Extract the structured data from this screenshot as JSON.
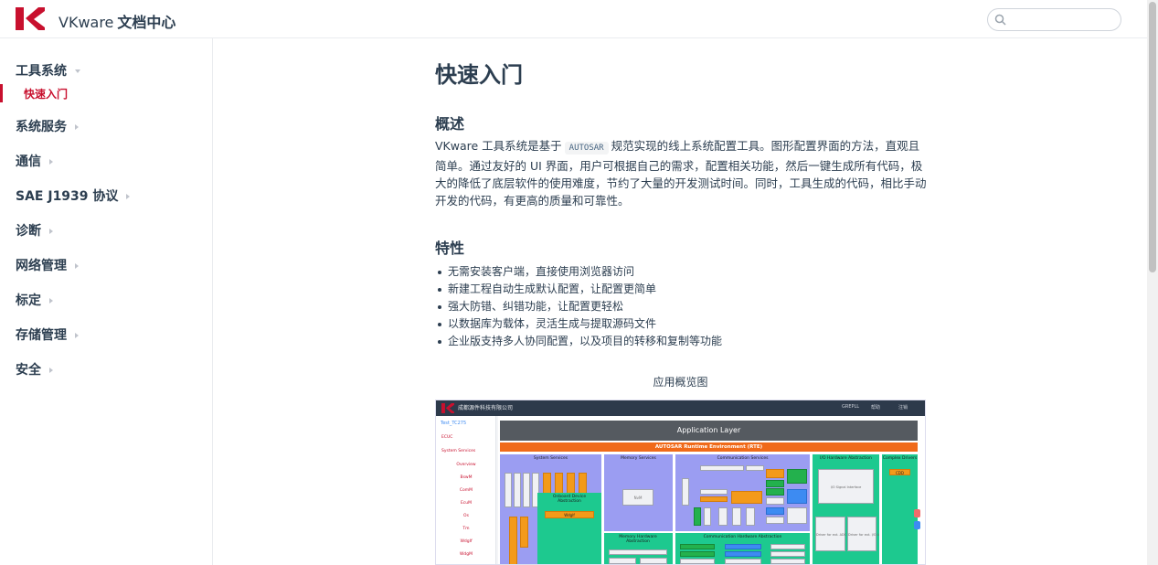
{
  "header": {
    "brand": "VKware",
    "subtitle": "文档中心",
    "search_placeholder": ""
  },
  "sidebar": {
    "groups": [
      {
        "label": "工具系统",
        "expanded": true,
        "children": [
          {
            "label": "快速入门",
            "active": true
          }
        ]
      },
      {
        "label": "系统服务",
        "expanded": false
      },
      {
        "label": "通信",
        "expanded": false
      },
      {
        "label": "SAE J1939 协议",
        "expanded": false
      },
      {
        "label": "诊断",
        "expanded": false
      },
      {
        "label": "网络管理",
        "expanded": false
      },
      {
        "label": "标定",
        "expanded": false
      },
      {
        "label": "存储管理",
        "expanded": false
      },
      {
        "label": "安全",
        "expanded": false
      }
    ]
  },
  "content": {
    "title": "快速入门",
    "overview_heading": "概述",
    "overview_before_code": "VKware 工具系统是基于",
    "overview_code": "AUTOSAR",
    "overview_after_code": "规范实现的线上系统配置工具。图形配置界面的方法，直观且简单。通过友好的 UI 界面，用户可根据自己的需求，配置相关功能，然后一键生成所有代码，极大的降低了底层软件的使用难度，节约了大量的开发测试时间。同时，工具生成的代码，相比手动开发的代码，有更高的质量和可靠性。",
    "features_heading": "特性",
    "features": [
      "无需安装客户端，直接使用浏览器访问",
      "新建工程自动生成默认配置，让配置更简单",
      "强大防错、纠错功能，让配置更轻松",
      "以数据库为载体，灵活生成与提取源码文件",
      "企业版支持多人协同配置，以及项目的转移和复制等功能"
    ],
    "caption": "应用概览图"
  },
  "diagram": {
    "company": "成都源件科技有限公司",
    "top_links": [
      "GREPLL",
      "帮助",
      "注销"
    ],
    "project": "Test_TC275",
    "side_items": [
      "ECUC",
      "System Services",
      "Overview",
      "BswM",
      "ComM",
      "EcuM",
      "Os",
      "Tm",
      "WdgIf",
      "WdgM"
    ],
    "app_layer": "Application Layer",
    "rte": "AUTOSAR Runtime Environment (RTE)",
    "system_services": "System Services",
    "memory_services": "Memory Services",
    "communication_services": "Communication Services",
    "io_hw": "I/O Hardware Abstraction",
    "complex_drivers": "Complex Drivers",
    "cdd": "CDD",
    "onboard": "Onboard Device Abstraction",
    "memhw": "Memory Hardware Abstraction",
    "comhw": "Communication Hardware Abstraction",
    "io_signal": "I/O Signal Interface",
    "driver_mcu": "Driver for ext. ADC ASIC",
    "driver_io": "Driver for ext. I/O ASIC",
    "nvm": "NvM",
    "wdgif": "WdgIf",
    "colors": {
      "blue": "#9b9df2",
      "green": "#1dc98f",
      "orange": "#f06a1a",
      "dark": "#555a60"
    }
  }
}
